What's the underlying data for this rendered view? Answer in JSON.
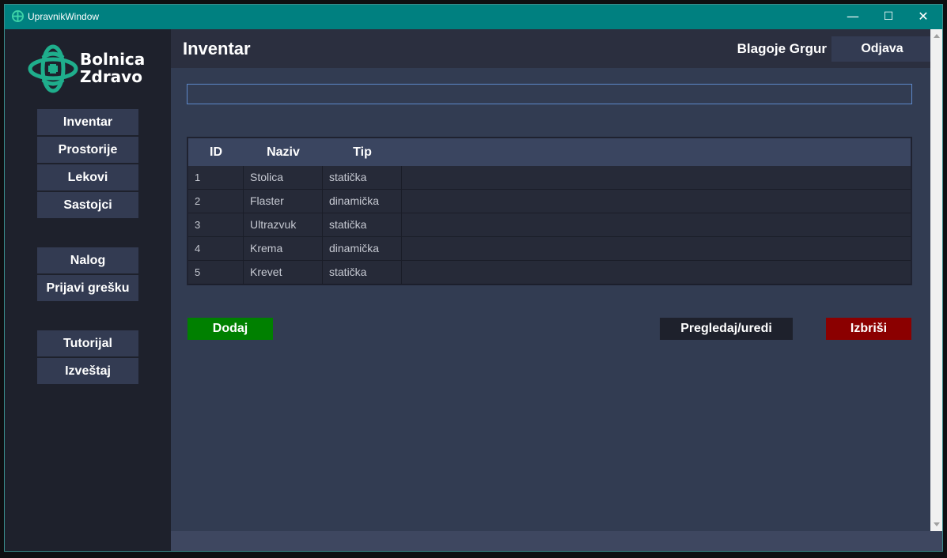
{
  "window": {
    "title": "UpravnikWindow",
    "minimize": "—",
    "maximize": "☐",
    "close": "✕"
  },
  "logo": {
    "line1": "Bolnica",
    "line2": "Zdravo",
    "icon": "hospital-cross-knot-icon",
    "color": "#1fae8c"
  },
  "sidebar": {
    "items": [
      {
        "label": "Inventar"
      },
      {
        "label": "Prostorije"
      },
      {
        "label": "Lekovi"
      },
      {
        "label": "Sastojci"
      },
      {
        "label": "Nalog"
      },
      {
        "label": "Prijavi grešku"
      },
      {
        "label": "Tutorijal"
      },
      {
        "label": "Izveštaj"
      }
    ]
  },
  "header": {
    "title": "Inventar",
    "user": "Blagoje Grgur",
    "logout": "Odjava"
  },
  "search": {
    "value": "",
    "placeholder": ""
  },
  "table": {
    "columns": [
      "ID",
      "Naziv",
      "Tip"
    ],
    "rows": [
      {
        "id": "1",
        "naziv": "Stolica",
        "tip": "statička"
      },
      {
        "id": "2",
        "naziv": "Flaster",
        "tip": "dinamička"
      },
      {
        "id": "3",
        "naziv": "Ultrazvuk",
        "tip": "statička"
      },
      {
        "id": "4",
        "naziv": "Krema",
        "tip": "dinamička"
      },
      {
        "id": "5",
        "naziv": "Krevet",
        "tip": "statička"
      }
    ]
  },
  "actions": {
    "add": "Dodaj",
    "view_edit": "Pregledaj/uredi",
    "delete": "Izbriši"
  },
  "colors": {
    "titlebar": "#008080",
    "add": "#008000",
    "view_edit": "#1e212c",
    "delete": "#8b0000"
  }
}
